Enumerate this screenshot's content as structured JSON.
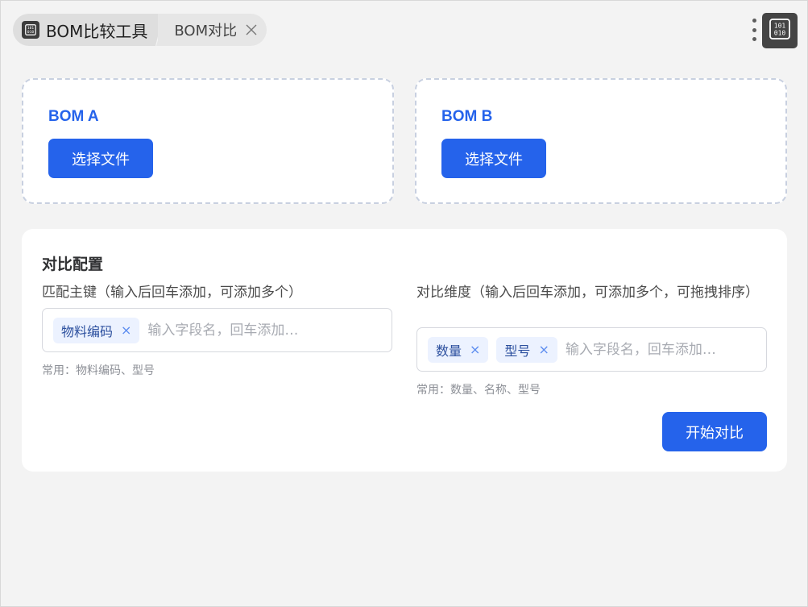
{
  "header": {
    "app_title": "BOM比较工具",
    "tab_label": "BOM对比",
    "app_icon": "binary-chip-icon",
    "close_icon": "close-icon",
    "more_icon": "more-vertical-icon"
  },
  "uploads": [
    {
      "title": "BOM A",
      "button_label": "选择文件"
    },
    {
      "title": "BOM B",
      "button_label": "选择文件"
    }
  ],
  "config": {
    "title": "对比配置",
    "match_keys": {
      "label": "匹配主键（输入后回车添加，可添加多个）",
      "tags": [
        "物料编码"
      ],
      "placeholder": "输入字段名，回车添加…",
      "hint": "常用：物料编码、型号"
    },
    "dimensions": {
      "label": "对比维度（输入后回车添加，可添加多个，可拖拽排序）",
      "tags": [
        "数量",
        "型号"
      ],
      "placeholder": "输入字段名，回车添加…",
      "hint": "常用：数量、名称、型号"
    },
    "start_button": "开始对比"
  },
  "colors": {
    "primary": "#2563eb",
    "tag_bg": "#ecf2ff",
    "background": "#f3f3f3"
  }
}
